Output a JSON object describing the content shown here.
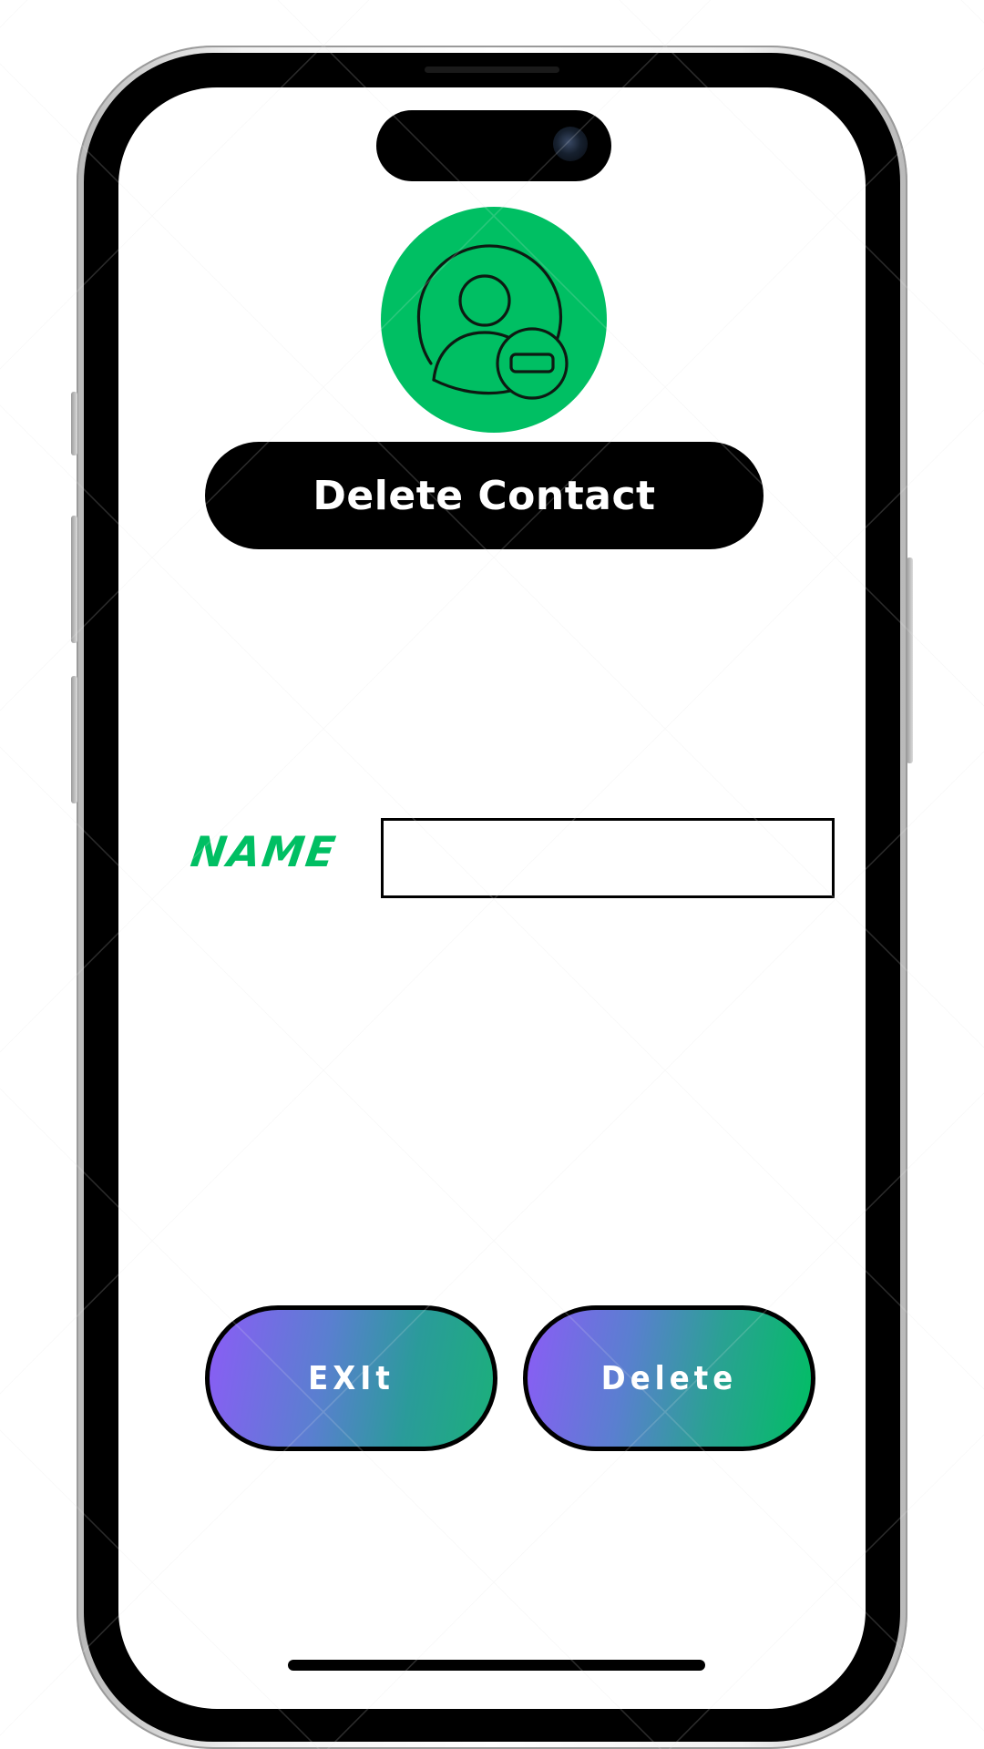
{
  "screen": {
    "title": "Delete Contact"
  },
  "form": {
    "name_label": "NAME",
    "name_value": "",
    "name_placeholder": ""
  },
  "actions": {
    "exit_label": "EXIt",
    "delete_label": "Delete"
  },
  "icons": {
    "header_icon": "user-minus-icon"
  },
  "colors": {
    "accent_green": "#00bf63",
    "gradient_purple": "#8b5cf6",
    "pill_black": "#000000"
  }
}
